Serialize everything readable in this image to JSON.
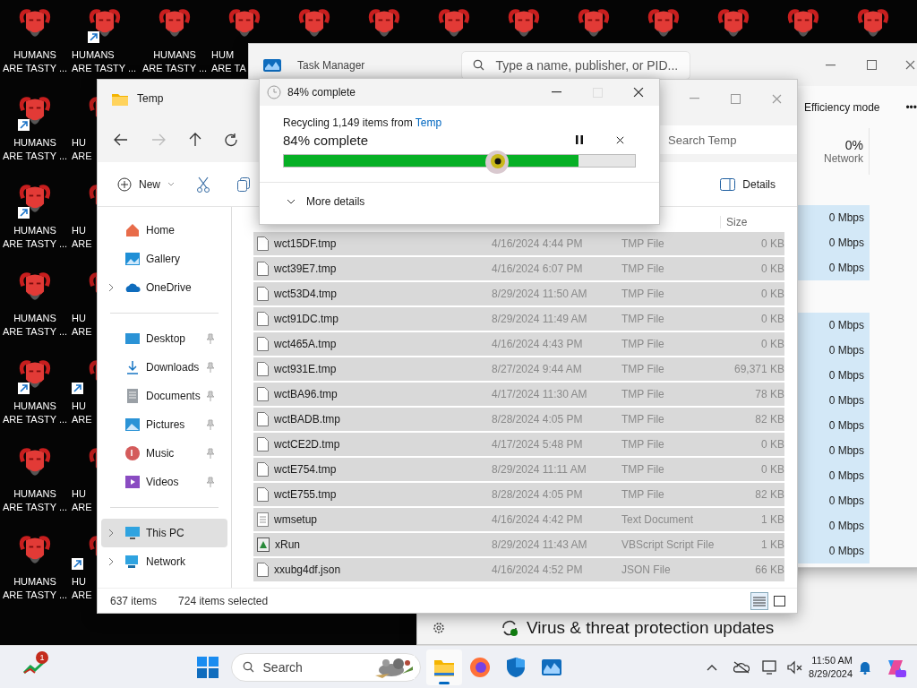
{
  "desktop": {
    "columns": [
      [
        {
          "lines": [
            "HUMANS",
            "ARE TASTY ..."
          ],
          "shortcut": false
        },
        {
          "lines": [
            "HUMANS",
            "ARE TASTY ..."
          ],
          "shortcut": true
        },
        {
          "lines": [
            "HUMANS",
            "ARE TASTY ..."
          ],
          "shortcut": true
        },
        {
          "lines": [
            "HUMANS",
            "ARE TASTY ..."
          ],
          "shortcut": false
        },
        {
          "lines": [
            "HUMANS",
            "ARE TASTY ..."
          ],
          "shortcut": true
        },
        {
          "lines": [
            "HUMANS",
            "ARE TASTY ..."
          ],
          "shortcut": false
        },
        {
          "lines": [
            "HUMANS",
            "ARE TASTY ..."
          ],
          "shortcut": false
        }
      ],
      [
        {
          "lines": [
            "HUMANS",
            "ARE TASTY ..."
          ],
          "shortcut": true
        },
        {
          "lines": [
            "HU",
            "ARE"
          ],
          "shortcut": false
        },
        {
          "lines": [
            "HU",
            "ARE"
          ],
          "shortcut": false
        },
        {
          "lines": [
            "HU",
            "ARE"
          ],
          "shortcut": false
        },
        {
          "lines": [
            "HU",
            "ARE"
          ],
          "shortcut": true
        },
        {
          "lines": [
            "HU",
            "ARE"
          ],
          "shortcut": false
        },
        {
          "lines": [
            "HU",
            "ARE"
          ],
          "shortcut": true
        }
      ],
      [
        {
          "lines": [
            "HUMANS",
            "ARE TASTY ..."
          ],
          "shortcut": false
        }
      ],
      [
        {
          "lines": [
            "HUM",
            "ARE TA"
          ],
          "shortcut": false
        }
      ],
      [
        {
          "shortcut": false
        }
      ],
      [
        {
          "shortcut": false
        }
      ],
      [
        {
          "shortcut": false
        }
      ],
      [
        {
          "shortcut": false
        }
      ],
      [
        {
          "shortcut": false
        }
      ],
      [
        {
          "shortcut": false
        }
      ],
      [
        {
          "shortcut": false
        }
      ],
      [
        {
          "shortcut": false
        }
      ],
      [
        {
          "shortcut": false
        }
      ]
    ]
  },
  "task_manager": {
    "title": "Task Manager",
    "search": {
      "placeholder": "Type a name, publisher, or PID..."
    },
    "toolbar": {
      "efficiency_mode": "Efficiency mode",
      "more": "•••"
    },
    "network_column": {
      "percent": "0%",
      "label": "Network"
    },
    "row_groups": [
      [
        "0 Mbps",
        "0 Mbps",
        "0 Mbps"
      ],
      [
        "0 Mbps",
        "0 Mbps",
        "0 Mbps",
        "0 Mbps",
        "0 Mbps",
        "0 Mbps",
        "0 Mbps",
        "0 Mbps",
        "0 Mbps",
        "0 Mbps"
      ]
    ]
  },
  "explorer": {
    "title": "Temp",
    "search": {
      "placeholder": "Search Temp"
    },
    "toolbar": {
      "new": "New",
      "details": "Details"
    },
    "sidebar": {
      "sections": [
        [
          {
            "label": "Home",
            "kind": "home",
            "selected": false,
            "expandable": false,
            "pinned": false
          },
          {
            "label": "Gallery",
            "kind": "gallery",
            "selected": false,
            "expandable": false,
            "pinned": false
          },
          {
            "label": "OneDrive",
            "kind": "cloud",
            "selected": false,
            "expandable": true,
            "pinned": false
          }
        ],
        [
          {
            "label": "Desktop",
            "kind": "desktop",
            "selected": false,
            "expandable": false,
            "pinned": true
          },
          {
            "label": "Downloads",
            "kind": "download",
            "selected": false,
            "expandable": false,
            "pinned": true
          },
          {
            "label": "Documents",
            "kind": "document",
            "selected": false,
            "expandable": false,
            "pinned": true
          },
          {
            "label": "Pictures",
            "kind": "pictures",
            "selected": false,
            "expandable": false,
            "pinned": true
          },
          {
            "label": "Music",
            "kind": "music",
            "selected": false,
            "expandable": false,
            "pinned": true
          },
          {
            "label": "Videos",
            "kind": "videos",
            "selected": false,
            "expandable": false,
            "pinned": true
          }
        ],
        [
          {
            "label": "This PC",
            "kind": "pc",
            "selected": true,
            "expandable": true,
            "pinned": false
          },
          {
            "label": "Network",
            "kind": "network",
            "selected": false,
            "expandable": true,
            "pinned": false
          }
        ]
      ]
    },
    "columns": {
      "size": "Size"
    },
    "files": [
      {
        "name": "wct15DF.tmp",
        "date": "4/16/2024 4:44 PM",
        "type": "TMP File",
        "size": "0 KB",
        "kind": "file",
        "selected": true
      },
      {
        "name": "wct39E7.tmp",
        "date": "4/16/2024 6:07 PM",
        "type": "TMP File",
        "size": "0 KB",
        "kind": "file",
        "selected": true
      },
      {
        "name": "wct53D4.tmp",
        "date": "8/29/2024 11:50 AM",
        "type": "TMP File",
        "size": "0 KB",
        "kind": "file",
        "selected": true
      },
      {
        "name": "wct91DC.tmp",
        "date": "8/29/2024 11:49 AM",
        "type": "TMP File",
        "size": "0 KB",
        "kind": "file",
        "selected": true
      },
      {
        "name": "wct465A.tmp",
        "date": "4/16/2024 4:43 PM",
        "type": "TMP File",
        "size": "0 KB",
        "kind": "file",
        "selected": true
      },
      {
        "name": "wct931E.tmp",
        "date": "8/27/2024 9:44 AM",
        "type": "TMP File",
        "size": "69,371 KB",
        "kind": "file",
        "selected": true
      },
      {
        "name": "wctBA96.tmp",
        "date": "4/17/2024 11:30 AM",
        "type": "TMP File",
        "size": "78 KB",
        "kind": "file",
        "selected": true
      },
      {
        "name": "wctBADB.tmp",
        "date": "8/28/2024 4:05 PM",
        "type": "TMP File",
        "size": "82 KB",
        "kind": "file",
        "selected": true
      },
      {
        "name": "wctCE2D.tmp",
        "date": "4/17/2024 5:48 PM",
        "type": "TMP File",
        "size": "0 KB",
        "kind": "file",
        "selected": true
      },
      {
        "name": "wctE754.tmp",
        "date": "8/29/2024 11:11 AM",
        "type": "TMP File",
        "size": "0 KB",
        "kind": "file",
        "selected": true
      },
      {
        "name": "wctE755.tmp",
        "date": "8/28/2024 4:05 PM",
        "type": "TMP File",
        "size": "82 KB",
        "kind": "file",
        "selected": true
      },
      {
        "name": "wmsetup",
        "date": "4/16/2024 4:42 PM",
        "type": "Text Document",
        "size": "1 KB",
        "kind": "text",
        "selected": true
      },
      {
        "name": "xRun",
        "date": "8/29/2024 11:43 AM",
        "type": "VBScript Script File",
        "size": "1 KB",
        "kind": "script",
        "selected": true
      },
      {
        "name": "xxubg4df.json",
        "date": "4/16/2024 4:52 PM",
        "type": "JSON File",
        "size": "66 KB",
        "kind": "file",
        "selected": true
      }
    ],
    "status": {
      "count": "637 items",
      "selected": "724 items selected"
    }
  },
  "progress_dialog": {
    "title": "84% complete",
    "message_prefix": "Recycling 1,149 items from",
    "message_link": "Temp",
    "heading": "84% complete",
    "level": 0.84,
    "more_details": "More details"
  },
  "security": {
    "heading": "Virus & threat protection updates"
  },
  "taskbar": {
    "widget_badge": "1",
    "search": {
      "placeholder": "Search"
    },
    "apps": [
      {
        "kind": "explorer",
        "selected": true
      },
      {
        "kind": "firefox",
        "selected": false
      },
      {
        "kind": "defender",
        "selected": false
      },
      {
        "kind": "taskmanager",
        "selected": false
      }
    ],
    "time": "11:50 AM",
    "date": "8/29/2024"
  }
}
